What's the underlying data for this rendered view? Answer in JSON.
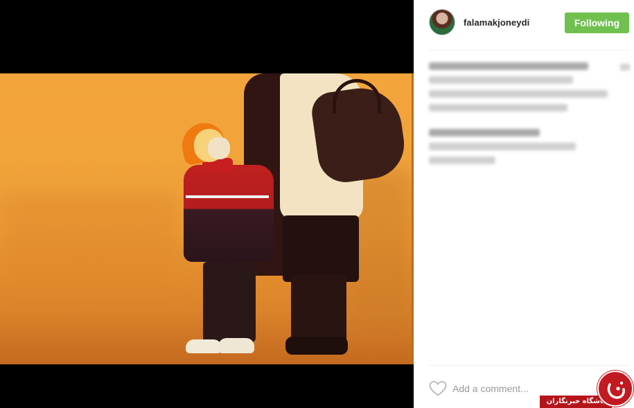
{
  "post": {
    "username": "falamakjoneydi",
    "follow_label": "Following",
    "comment_placeholder": "Add a comment..."
  },
  "watermark": {
    "text": "باشگاه خبرنگاران"
  },
  "icons": {
    "like": "heart-outline-icon",
    "more": "more-options-icon",
    "logo": "news-agency-logo"
  },
  "colors": {
    "follow_button": "#70c050",
    "watermark": "#b5151a",
    "photo_tint": "#f0a33a"
  }
}
